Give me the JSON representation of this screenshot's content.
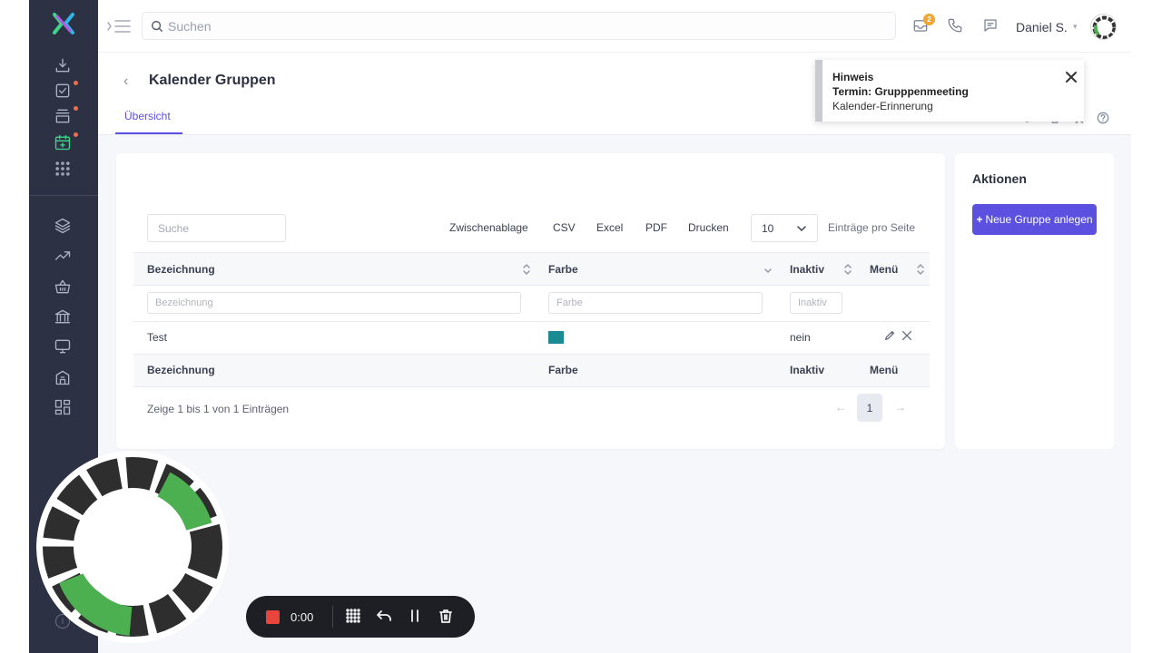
{
  "topbar": {
    "search_placeholder": "Suchen",
    "notification_count": "2",
    "user_name": "Daniel S.",
    "user_caret": "▾"
  },
  "sidebar": {
    "top_items": [
      {
        "icon": "download-icon",
        "dot": false
      },
      {
        "icon": "task-edit-icon",
        "dot": true
      },
      {
        "icon": "inbox-stack-icon",
        "dot": true
      },
      {
        "icon": "calendar-add-icon",
        "dot": true,
        "active": true
      },
      {
        "icon": "apps-grid-icon",
        "dot": false
      }
    ],
    "bottom_items": [
      {
        "icon": "layers-icon"
      },
      {
        "icon": "trending-up-icon"
      },
      {
        "icon": "basket-icon"
      },
      {
        "icon": "bank-icon"
      },
      {
        "icon": "monitor-icon"
      },
      {
        "icon": "building-lock-icon"
      },
      {
        "icon": "dashboard-icon"
      }
    ],
    "info_glyph": "i"
  },
  "page": {
    "back_glyph": "‹",
    "title": "Kalender Gruppen",
    "tab_label": "Übersicht"
  },
  "table_toolbar": {
    "search_placeholder": "Suche",
    "buttons": [
      "Zwischenablage",
      "CSV",
      "Excel",
      "PDF",
      "Drucken"
    ],
    "per_page_value": "10",
    "per_page_label": "Einträge pro Seite"
  },
  "table": {
    "columns": [
      "Bezeichnung",
      "Farbe",
      "Inaktiv",
      "Menü"
    ],
    "filters": [
      "Bezeichnung",
      "Farbe",
      "Inaktiv"
    ],
    "rows": [
      {
        "bezeichnung": "Test",
        "farbe": "#1b8b93",
        "inaktiv": "nein"
      }
    ],
    "info": "Zeige 1 bis 1 von 1 Einträgen",
    "pagination": {
      "prev": "←",
      "current": "1",
      "next": "→"
    }
  },
  "actions_panel": {
    "title": "Aktionen",
    "new_group_icon": "+",
    "new_group_label": "Neue Gruppe anlegen"
  },
  "toast": {
    "title": "Hinweis",
    "subject": "Termin: Grupppenmeeting",
    "body": "Kalender-Erinnerung"
  },
  "recorder": {
    "time": "0:00"
  },
  "colors": {
    "accent": "#5b50e0",
    "sidebar_bg": "#2c3244",
    "active_icon": "#3ed68b",
    "notification_dot": "#f26b4a",
    "badge": "#f1a532",
    "record_stop": "#e8453c"
  }
}
